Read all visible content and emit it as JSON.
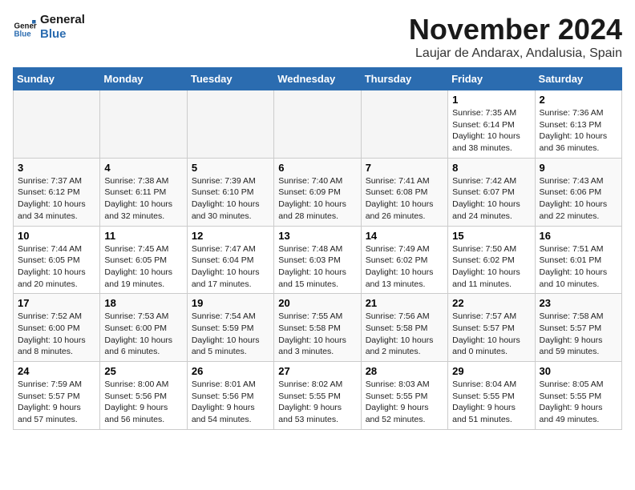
{
  "logo": {
    "line1": "General",
    "line2": "Blue"
  },
  "title": "November 2024",
  "location": "Laujar de Andarax, Andalusia, Spain",
  "weekdays": [
    "Sunday",
    "Monday",
    "Tuesday",
    "Wednesday",
    "Thursday",
    "Friday",
    "Saturday"
  ],
  "weeks": [
    [
      {
        "day": "",
        "info": ""
      },
      {
        "day": "",
        "info": ""
      },
      {
        "day": "",
        "info": ""
      },
      {
        "day": "",
        "info": ""
      },
      {
        "day": "",
        "info": ""
      },
      {
        "day": "1",
        "info": "Sunrise: 7:35 AM\nSunset: 6:14 PM\nDaylight: 10 hours and 38 minutes."
      },
      {
        "day": "2",
        "info": "Sunrise: 7:36 AM\nSunset: 6:13 PM\nDaylight: 10 hours and 36 minutes."
      }
    ],
    [
      {
        "day": "3",
        "info": "Sunrise: 7:37 AM\nSunset: 6:12 PM\nDaylight: 10 hours and 34 minutes."
      },
      {
        "day": "4",
        "info": "Sunrise: 7:38 AM\nSunset: 6:11 PM\nDaylight: 10 hours and 32 minutes."
      },
      {
        "day": "5",
        "info": "Sunrise: 7:39 AM\nSunset: 6:10 PM\nDaylight: 10 hours and 30 minutes."
      },
      {
        "day": "6",
        "info": "Sunrise: 7:40 AM\nSunset: 6:09 PM\nDaylight: 10 hours and 28 minutes."
      },
      {
        "day": "7",
        "info": "Sunrise: 7:41 AM\nSunset: 6:08 PM\nDaylight: 10 hours and 26 minutes."
      },
      {
        "day": "8",
        "info": "Sunrise: 7:42 AM\nSunset: 6:07 PM\nDaylight: 10 hours and 24 minutes."
      },
      {
        "day": "9",
        "info": "Sunrise: 7:43 AM\nSunset: 6:06 PM\nDaylight: 10 hours and 22 minutes."
      }
    ],
    [
      {
        "day": "10",
        "info": "Sunrise: 7:44 AM\nSunset: 6:05 PM\nDaylight: 10 hours and 20 minutes."
      },
      {
        "day": "11",
        "info": "Sunrise: 7:45 AM\nSunset: 6:05 PM\nDaylight: 10 hours and 19 minutes."
      },
      {
        "day": "12",
        "info": "Sunrise: 7:47 AM\nSunset: 6:04 PM\nDaylight: 10 hours and 17 minutes."
      },
      {
        "day": "13",
        "info": "Sunrise: 7:48 AM\nSunset: 6:03 PM\nDaylight: 10 hours and 15 minutes."
      },
      {
        "day": "14",
        "info": "Sunrise: 7:49 AM\nSunset: 6:02 PM\nDaylight: 10 hours and 13 minutes."
      },
      {
        "day": "15",
        "info": "Sunrise: 7:50 AM\nSunset: 6:02 PM\nDaylight: 10 hours and 11 minutes."
      },
      {
        "day": "16",
        "info": "Sunrise: 7:51 AM\nSunset: 6:01 PM\nDaylight: 10 hours and 10 minutes."
      }
    ],
    [
      {
        "day": "17",
        "info": "Sunrise: 7:52 AM\nSunset: 6:00 PM\nDaylight: 10 hours and 8 minutes."
      },
      {
        "day": "18",
        "info": "Sunrise: 7:53 AM\nSunset: 6:00 PM\nDaylight: 10 hours and 6 minutes."
      },
      {
        "day": "19",
        "info": "Sunrise: 7:54 AM\nSunset: 5:59 PM\nDaylight: 10 hours and 5 minutes."
      },
      {
        "day": "20",
        "info": "Sunrise: 7:55 AM\nSunset: 5:58 PM\nDaylight: 10 hours and 3 minutes."
      },
      {
        "day": "21",
        "info": "Sunrise: 7:56 AM\nSunset: 5:58 PM\nDaylight: 10 hours and 2 minutes."
      },
      {
        "day": "22",
        "info": "Sunrise: 7:57 AM\nSunset: 5:57 PM\nDaylight: 10 hours and 0 minutes."
      },
      {
        "day": "23",
        "info": "Sunrise: 7:58 AM\nSunset: 5:57 PM\nDaylight: 9 hours and 59 minutes."
      }
    ],
    [
      {
        "day": "24",
        "info": "Sunrise: 7:59 AM\nSunset: 5:57 PM\nDaylight: 9 hours and 57 minutes."
      },
      {
        "day": "25",
        "info": "Sunrise: 8:00 AM\nSunset: 5:56 PM\nDaylight: 9 hours and 56 minutes."
      },
      {
        "day": "26",
        "info": "Sunrise: 8:01 AM\nSunset: 5:56 PM\nDaylight: 9 hours and 54 minutes."
      },
      {
        "day": "27",
        "info": "Sunrise: 8:02 AM\nSunset: 5:55 PM\nDaylight: 9 hours and 53 minutes."
      },
      {
        "day": "28",
        "info": "Sunrise: 8:03 AM\nSunset: 5:55 PM\nDaylight: 9 hours and 52 minutes."
      },
      {
        "day": "29",
        "info": "Sunrise: 8:04 AM\nSunset: 5:55 PM\nDaylight: 9 hours and 51 minutes."
      },
      {
        "day": "30",
        "info": "Sunrise: 8:05 AM\nSunset: 5:55 PM\nDaylight: 9 hours and 49 minutes."
      }
    ]
  ]
}
